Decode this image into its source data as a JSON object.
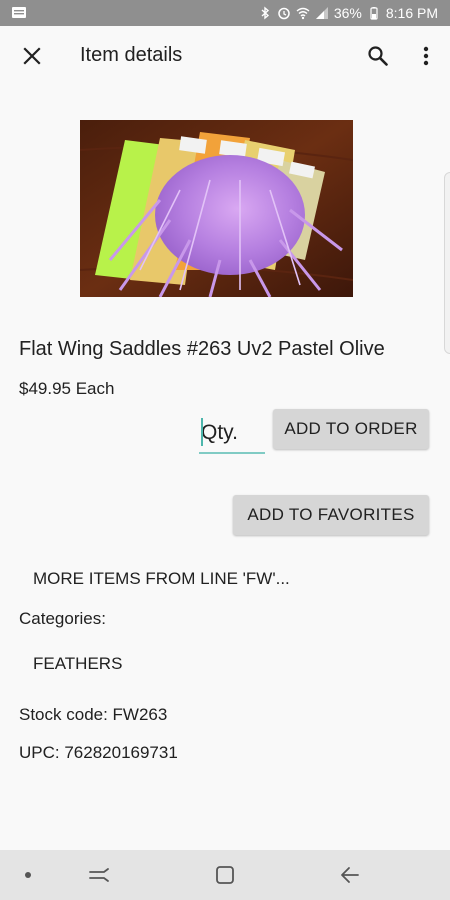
{
  "status_bar": {
    "battery_percent": "36%",
    "time": "8:16 PM",
    "background_color": "#8f8f8f",
    "icons": [
      "notification-icon",
      "bluetooth-icon",
      "alarm-icon",
      "wifi-icon",
      "signal-icon",
      "battery-icon"
    ]
  },
  "app_bar": {
    "title": "Item details",
    "close_icon": "close-icon",
    "search_icon": "search-icon",
    "more_icon": "more-vert-icon"
  },
  "product": {
    "image_description_icon": "product-photo",
    "title": "Flat Wing Saddles #263 Uv2 Pastel Olive",
    "price": "$49.95 Each"
  },
  "order": {
    "qty_placeholder": "Qty.",
    "add_to_order_label": "ADD TO ORDER",
    "add_to_favorites_label": "ADD TO FAVORITES",
    "accent_color": "#80cbc4"
  },
  "details": {
    "more_items_link": "MORE ITEMS FROM LINE 'FW'...",
    "categories_label": "Categories:",
    "categories": [
      "FEATHERS"
    ],
    "stock_code": "Stock code: FW263",
    "upc": "UPC: 762820169731"
  },
  "nav_bar": {
    "icons": [
      "nav-dot-icon",
      "recent-apps-icon",
      "home-icon",
      "back-icon"
    ]
  }
}
